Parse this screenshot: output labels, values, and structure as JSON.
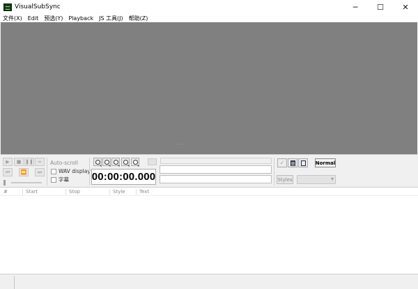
{
  "window": {
    "title": "VisualSubSync",
    "minimize_glyph": "─",
    "maximize_glyph": "☐",
    "close_glyph": "✕"
  },
  "menu": [
    "文件(X)",
    "Edit",
    "预选(Y)",
    "Playback",
    "JS 工具(J)",
    "帮助(Z)"
  ],
  "playback": {
    "play_icon": "▶",
    "stop_icon": "■",
    "pause_icon": "❚❚",
    "loop_icon": "∞",
    "prev_icon": "⏮",
    "ffwd_icon": "⏩",
    "next_icon": "⏭"
  },
  "options": {
    "autoscroll_label": "Auto-scroll",
    "wav_display_label": "WAV display",
    "subtitle_label": "字幕"
  },
  "time_display": "00:00:00.000",
  "toolbar": {
    "normal_label": "Normal",
    "styles_label": "Styles",
    "check_glyph": "✓"
  },
  "list_columns": [
    "#",
    "Start",
    "Stop",
    "Style",
    "Text"
  ],
  "colors": {
    "waveform_bg": "#808080",
    "panel_bg": "#f0f0f0"
  }
}
